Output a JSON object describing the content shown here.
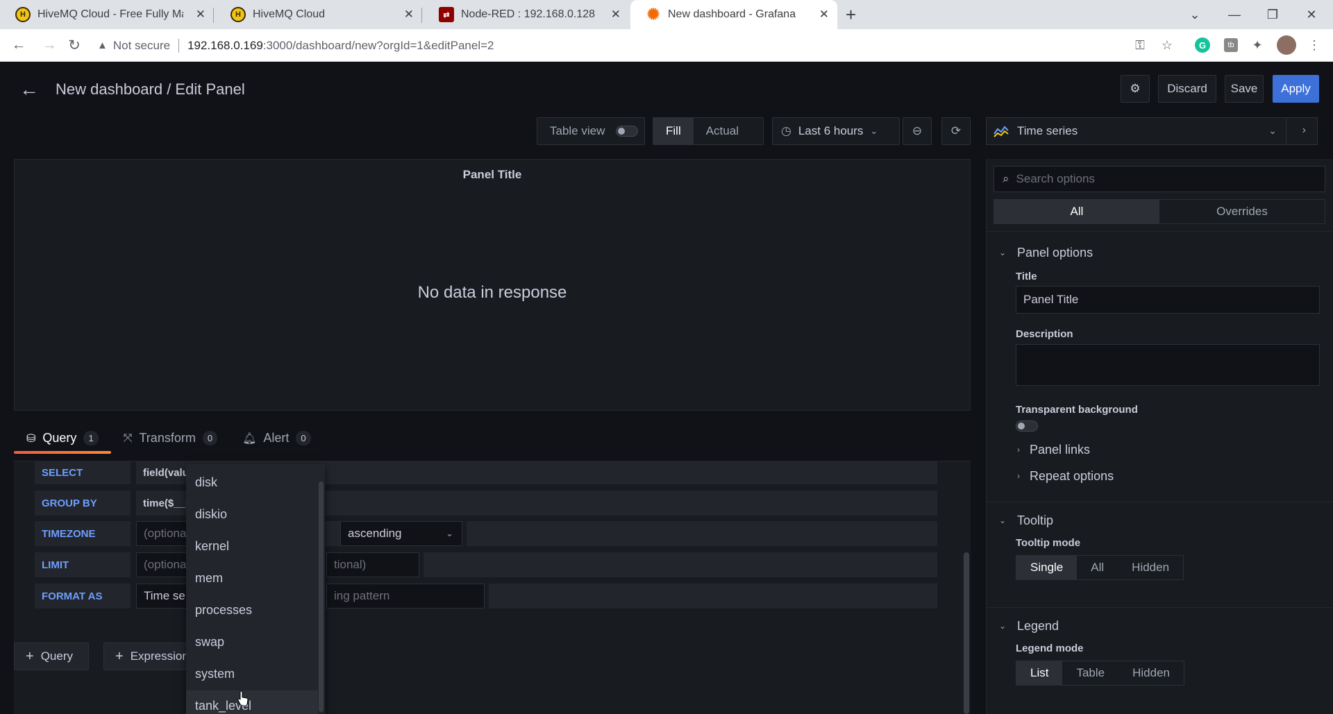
{
  "browser": {
    "tabs": [
      {
        "title": "HiveMQ Cloud - Free Fully Mana",
        "icon": "hivemq-icon"
      },
      {
        "title": "HiveMQ Cloud",
        "icon": "hivemq-icon"
      },
      {
        "title": "Node-RED : 192.168.0.128",
        "icon": "node-red-icon"
      },
      {
        "title": "New dashboard - Grafana",
        "icon": "grafana-icon"
      }
    ],
    "not_secure": "Not secure",
    "url_host": "192.168.0.169",
    "url_path": ":3000/dashboard/new?orgId=1&editPanel=2"
  },
  "header": {
    "title": "New dashboard / Edit Panel",
    "discard": "Discard",
    "save": "Save",
    "apply": "Apply"
  },
  "toolbar": {
    "table_view": "Table view",
    "fill": "Fill",
    "actual": "Actual",
    "time_range": "Last 6 hours"
  },
  "panel": {
    "title": "Panel Title",
    "no_data": "No data in response"
  },
  "query_tabs": [
    {
      "label": "Query",
      "count": "1"
    },
    {
      "label": "Transform",
      "count": "0"
    },
    {
      "label": "Alert",
      "count": "0"
    }
  ],
  "query_editor": {
    "select_label": "SELECT",
    "select_value": "field(valu",
    "group_label": "GROUP BY",
    "group_value": "time($__i",
    "timezone_label": "TIMEZONE",
    "timezone_ph": "(optiona",
    "order_label_tail": "E",
    "order_value": "ascending",
    "limit_label": "LIMIT",
    "limit_ph": "(optiona",
    "slimit_ph": "tional)",
    "format_label": "FORMAT AS",
    "format_value": "Time se",
    "alias_ph": "ing pattern"
  },
  "add_buttons": {
    "query": "Query",
    "expression": "Expression"
  },
  "dropdown": {
    "items": [
      "disk",
      "diskio",
      "kernel",
      "mem",
      "processes",
      "swap",
      "system",
      "tank_level"
    ],
    "hovered": "tank_level"
  },
  "options": {
    "visualization": "Time series",
    "search_placeholder": "Search options",
    "tab_all": "All",
    "tab_overrides": "Overrides",
    "panel_options": "Panel options",
    "title_label": "Title",
    "title_value": "Panel Title",
    "description_label": "Description",
    "transparent_label": "Transparent background",
    "panel_links": "Panel links",
    "repeat_options": "Repeat options",
    "tooltip": "Tooltip",
    "tooltip_mode_label": "Tooltip mode",
    "tooltip_modes": [
      "Single",
      "All",
      "Hidden"
    ],
    "legend": "Legend",
    "legend_mode_label": "Legend mode",
    "legend_modes": [
      "List",
      "Table",
      "Hidden"
    ]
  },
  "colors": {
    "accent": "#3d71d9",
    "tab_underline": "#ff8833",
    "label_blue": "#6e9fff"
  }
}
